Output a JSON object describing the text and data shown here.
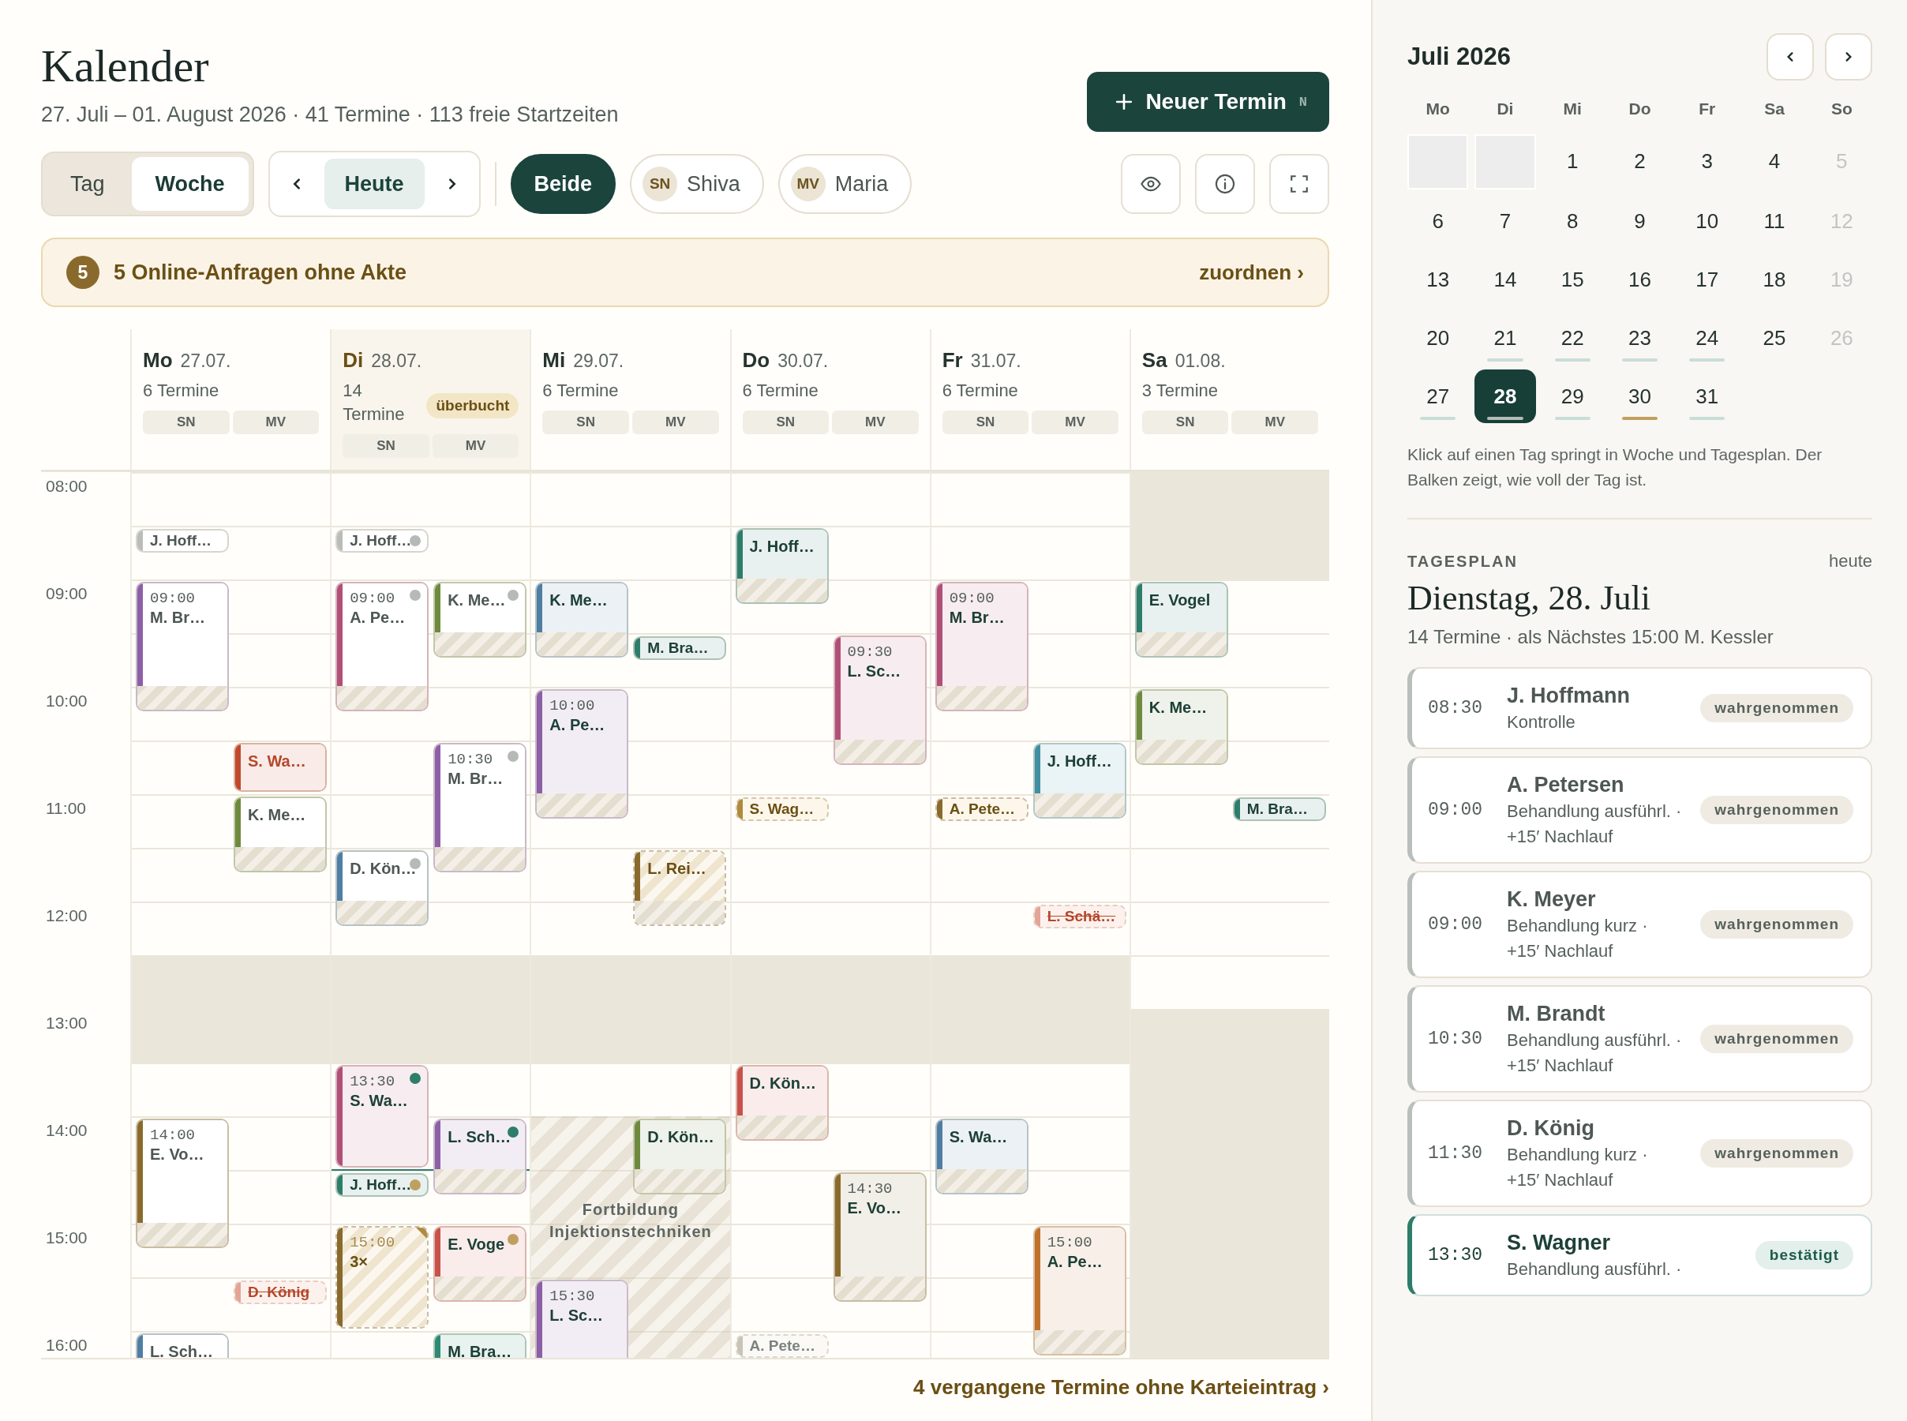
{
  "header": {
    "title": "Kalender",
    "subtitle": "27. Juli – 01. August 2026 · 41 Termine · 113 freie Startzeiten",
    "new_button": "Neuer Termin",
    "shortcut": "N"
  },
  "view_toggle": [
    {
      "label": "Tag",
      "selected": false
    },
    {
      "label": "Woche",
      "selected": true
    }
  ],
  "nav": {
    "today": "Heute"
  },
  "filters": [
    {
      "label": "Beide",
      "selected": true
    },
    {
      "initials": "SN",
      "label": "Shiva",
      "selected": false
    },
    {
      "initials": "MV",
      "label": "Maria",
      "selected": false
    }
  ],
  "banner": {
    "count": "5",
    "text": "5 Online-Anfragen ohne Akte",
    "action": "zuordnen ›"
  },
  "time_labels": [
    "08:00",
    "09:00",
    "10:00",
    "11:00",
    "12:00",
    "13:00",
    "14:00",
    "15:00",
    "16:00"
  ],
  "days": [
    {
      "name": "Mo",
      "date": "27.07.",
      "count": "6 Termine",
      "lanes": [
        "SN",
        "MV"
      ],
      "highlighted": false,
      "slots": [
        {
          "closed": false
        },
        {
          "closed": false,
          "sn": [
            {
              "kind": "pill-done",
              "label": "J. Hoff…",
              "color": "#b9bdb8"
            }
          ]
        },
        {
          "closed": false,
          "sn": [
            {
              "kind": "block-done",
              "long": true,
              "nachlauf": true,
              "time": "09:00",
              "label": "M. Br…",
              "color": "#8d5fa6"
            }
          ]
        },
        {
          "closed": false
        },
        {
          "closed": false
        },
        {
          "closed": false,
          "mv": [
            {
              "kind": "block-missed",
              "long": false,
              "nachlauf": false,
              "label": "S. Wa…",
              "color": "#c0482c"
            }
          ]
        },
        {
          "closed": false,
          "mv": [
            {
              "kind": "block-done",
              "long": false,
              "nachlauf": true,
              "label": "K. Me…",
              "color": "#6e8a3c"
            }
          ]
        },
        {
          "closed": false
        },
        {
          "closed": false
        },
        {
          "closed": true
        },
        {
          "closed": true
        },
        {
          "closed": false
        },
        {
          "closed": false,
          "sn": [
            {
              "kind": "block-done",
              "long": true,
              "nachlauf": true,
              "time": "14:00",
              "label": "E. Vo…",
              "color": "#8a6a2c"
            }
          ]
        },
        {
          "closed": false
        },
        {
          "closed": false
        },
        {
          "closed": false,
          "mv": [
            {
              "kind": "pill-cancelled",
              "label": "D. König",
              "color": "#e3a595"
            }
          ]
        },
        {
          "closed": false,
          "sn": [
            {
              "kind": "block-done",
              "long": false,
              "nachlauf": false,
              "label": "L. Sch…",
              "color": "#4f7ea3"
            }
          ]
        }
      ]
    },
    {
      "name": "Di",
      "date": "28.07.",
      "count": "14 Termine",
      "badge": "überbucht",
      "lanes": [
        "SN",
        "MV"
      ],
      "highlighted": true,
      "slots": [
        {
          "closed": false,
          "now": false
        },
        {
          "closed": false,
          "now": false,
          "sn": [
            {
              "kind": "pill-done",
              "label": "J. Hoff…",
              "color": "#b9bdb8",
              "dot": {
                "color": "#b5bab6"
              }
            }
          ]
        },
        {
          "closed": false,
          "now": false,
          "sn": [
            {
              "kind": "block-done",
              "long": true,
              "nachlauf": true,
              "time": "09:00",
              "label": "A. Pe…",
              "color": "#b24f78",
              "dot": {
                "color": "#b5bab6"
              }
            }
          ],
          "mv": [
            {
              "kind": "block-done",
              "long": false,
              "nachlauf": true,
              "label": "K. Me…",
              "color": "#6e8a3c",
              "dot": {
                "color": "#b5bab6"
              }
            }
          ]
        },
        {
          "closed": false,
          "now": false
        },
        {
          "closed": false,
          "now": false
        },
        {
          "closed": false,
          "now": false,
          "mv": [
            {
              "kind": "block-done",
              "long": true,
              "nachlauf": true,
              "time": "10:30",
              "label": "M. Br…",
              "color": "#8d5fa6",
              "dot": {
                "color": "#b5bab6"
              }
            }
          ]
        },
        {
          "closed": false,
          "now": false
        },
        {
          "closed": false,
          "now": false,
          "sn": [
            {
              "kind": "block-done",
              "long": false,
              "nachlauf": true,
              "label": "D. Kön…",
              "color": "#4f7ea3",
              "dot": {
                "color": "#b5bab6"
              }
            }
          ]
        },
        {
          "closed": false,
          "now": false
        },
        {
          "closed": true,
          "now": false
        },
        {
          "closed": true,
          "now": false
        },
        {
          "closed": false,
          "now": false,
          "sn": [
            {
              "kind": "block-confirmed",
              "long": true,
              "nachlauf": false,
              "time": "13:30",
              "label": "S. Wa…",
              "color": "#b24f78",
              "dot": {
                "color": "#2e7d6b"
              }
            }
          ]
        },
        {
          "closed": false,
          "now": false,
          "mv": [
            {
              "kind": "block-confirmed",
              "long": false,
              "nachlauf": true,
              "label": "L. Sch…",
              "color": "#8d5fa6",
              "dot": {
                "color": "#2e7d6b"
              }
            }
          ]
        },
        {
          "closed": false,
          "now": true,
          "sn": [
            {
              "kind": "pill-confirmed",
              "label": "J. Hoff…",
              "color": "#2e7d6b",
              "dot": {
                "color": "#c0a060"
              }
            }
          ]
        },
        {
          "closed": false,
          "now": false,
          "sn": [
            {
              "kind": "group",
              "long": true,
              "nachlauf": false,
              "time": "15:00",
              "label": "3×",
              "color": "#8a6a2c"
            }
          ],
          "mv": [
            {
              "kind": "block-confirmed",
              "long": false,
              "nachlauf": true,
              "label": "E. Voge",
              "color": "#c8524a",
              "dot": {
                "color": "#c0a060"
              }
            }
          ]
        },
        {
          "closed": false,
          "now": false
        },
        {
          "closed": false,
          "now": false,
          "mv": [
            {
              "kind": "block-confirmed",
              "long": false,
              "nachlauf": false,
              "label": "M. Bra…",
              "color": "#2e8a72"
            }
          ]
        }
      ]
    },
    {
      "name": "Mi",
      "date": "29.07.",
      "count": "6 Termine",
      "lanes": [
        "SN",
        "MV"
      ],
      "highlighted": false,
      "slots": [
        {
          "closed": false
        },
        {
          "closed": false
        },
        {
          "closed": false,
          "sn": [
            {
              "kind": "block-confirmed",
              "long": false,
              "nachlauf": true,
              "label": "K. Me…",
              "color": "#4f7ea3"
            }
          ]
        },
        {
          "closed": false,
          "mv": [
            {
              "kind": "pill-confirmed",
              "label": "M. Bra…",
              "color": "#2e7d6b"
            }
          ]
        },
        {
          "closed": false,
          "sn": [
            {
              "kind": "block-confirmed",
              "long": true,
              "nachlauf": true,
              "time": "10:00",
              "label": "A. Pe…",
              "color": "#8d5fa6"
            }
          ]
        },
        {
          "closed": false
        },
        {
          "closed": false
        },
        {
          "closed": false,
          "mv": [
            {
              "kind": "block-request",
              "long": false,
              "nachlauf": true,
              "label": "L. Rei…",
              "color": "#8a6a2c"
            }
          ]
        },
        {
          "closed": false
        },
        {
          "closed": true
        },
        {
          "closed": true
        },
        {
          "closed": false
        },
        {
          "closed": false,
          "mv": [
            {
              "kind": "block-confirmed",
              "long": false,
              "nachlauf": true,
              "label": "D. Kön…",
              "color": "#6e8a3c"
            }
          ],
          "training": {
            "label": "Fortbildung Injektionstechniken"
          }
        },
        {
          "closed": false
        },
        {
          "closed": false
        },
        {
          "closed": false,
          "sn": [
            {
              "kind": "block-confirmed",
              "long": true,
              "nachlauf": false,
              "time": "15:30",
              "label": "L. Sc…",
              "color": "#8d5fa6"
            }
          ]
        },
        {
          "closed": false
        }
      ]
    },
    {
      "name": "Do",
      "date": "30.07.",
      "count": "6 Termine",
      "lanes": [
        "SN",
        "MV"
      ],
      "highlighted": false,
      "slots": [
        {
          "closed": false
        },
        {
          "closed": false,
          "sn": [
            {
              "kind": "block-confirmed",
              "long": false,
              "nachlauf": true,
              "label": "J. Hoff…",
              "color": "#2e7d6b"
            }
          ]
        },
        {
          "closed": false
        },
        {
          "closed": false,
          "mv": [
            {
              "kind": "block-confirmed",
              "long": true,
              "nachlauf": true,
              "time": "09:30",
              "label": "L. Sc…",
              "color": "#b24f78"
            }
          ]
        },
        {
          "closed": false
        },
        {
          "closed": false
        },
        {
          "closed": false,
          "sn": [
            {
              "kind": "pill-request",
              "label": "S. Wag…",
              "color": "#b08a3e"
            }
          ]
        },
        {
          "closed": false
        },
        {
          "closed": false
        },
        {
          "closed": true
        },
        {
          "closed": true
        },
        {
          "closed": false,
          "sn": [
            {
              "kind": "block-confirmed",
              "long": false,
              "nachlauf": true,
              "label": "D. Kön…",
              "color": "#c8524a"
            }
          ]
        },
        {
          "closed": false
        },
        {
          "closed": false,
          "mv": [
            {
              "kind": "block-confirmed",
              "long": true,
              "nachlauf": true,
              "time": "14:30",
              "label": "E. Vo…",
              "color": "#8a6a2c"
            }
          ]
        },
        {
          "closed": false
        },
        {
          "closed": false
        },
        {
          "closed": false,
          "sn": [
            {
              "kind": "pill-lapsed",
              "label": "A. Pete…",
              "color": "#c9c4b8"
            }
          ]
        }
      ]
    },
    {
      "name": "Fr",
      "date": "31.07.",
      "count": "6 Termine",
      "lanes": [
        "SN",
        "MV"
      ],
      "highlighted": false,
      "slots": [
        {
          "closed": false
        },
        {
          "closed": false
        },
        {
          "closed": false,
          "sn": [
            {
              "kind": "block-confirmed",
              "long": true,
              "nachlauf": true,
              "time": "09:00",
              "label": "M. Br…",
              "color": "#b24f78"
            }
          ]
        },
        {
          "closed": false
        },
        {
          "closed": false
        },
        {
          "closed": false,
          "mv": [
            {
              "kind": "block-confirmed",
              "long": false,
              "nachlauf": true,
              "label": "J. Hoff…",
              "color": "#3f8fa0"
            }
          ]
        },
        {
          "closed": false,
          "sn": [
            {
              "kind": "pill-request",
              "label": "A. Pete…",
              "color": "#8a6a2c"
            }
          ]
        },
        {
          "closed": false
        },
        {
          "closed": false,
          "mv": [
            {
              "kind": "pill-cancelled",
              "label": "L. Schä…",
              "color": "#e3a595"
            }
          ]
        },
        {
          "closed": true
        },
        {
          "closed": true
        },
        {
          "closed": false
        },
        {
          "closed": false,
          "sn": [
            {
              "kind": "block-confirmed",
              "long": false,
              "nachlauf": true,
              "label": "S. Wa…",
              "color": "#4f7ea3"
            }
          ]
        },
        {
          "closed": false
        },
        {
          "closed": false,
          "mv": [
            {
              "kind": "block-confirmed",
              "long": true,
              "nachlauf": true,
              "time": "15:00",
              "label": "A. Pe…",
              "color": "#c0722d"
            }
          ]
        },
        {
          "closed": false
        },
        {
          "closed": false
        }
      ]
    },
    {
      "name": "Sa",
      "date": "01.08.",
      "count": "3 Termine",
      "lanes": [
        "SN",
        "MV"
      ],
      "highlighted": false,
      "slots": [
        {
          "closed": true
        },
        {
          "closed": true
        },
        {
          "closed": false,
          "sn": [
            {
              "kind": "block-confirmed",
              "long": false,
              "nachlauf": true,
              "label": "E. Vogel",
              "color": "#2e7d6b"
            }
          ]
        },
        {
          "closed": false
        },
        {
          "closed": false,
          "sn": [
            {
              "kind": "block-confirmed",
              "long": false,
              "nachlauf": true,
              "label": "K. Me…",
              "color": "#6e8a3c"
            }
          ]
        },
        {
          "closed": false
        },
        {
          "closed": false,
          "mv": [
            {
              "kind": "pill-confirmed",
              "label": "M. Bra…",
              "color": "#2e7d6b"
            }
          ]
        },
        {
          "closed": false
        },
        {
          "closed": false
        },
        {
          "closed": false
        },
        {
          "closed": true
        },
        {
          "closed": true
        },
        {
          "closed": true
        },
        {
          "closed": true
        },
        {
          "closed": true
        },
        {
          "closed": true
        },
        {
          "closed": true
        }
      ]
    }
  ],
  "footer_link": "4 vergangene Termine ohne Karteieintrag ›",
  "mini_calendar": {
    "title": "Juli 2026",
    "weekdays": [
      "Mo",
      "Di",
      "Mi",
      "Do",
      "Fr",
      "Sa",
      "So"
    ],
    "weeks": [
      [
        {
          "kind": "blank"
        },
        {
          "kind": "blank"
        },
        {
          "kind": "day",
          "label": "1",
          "muted": false,
          "selected": false
        },
        {
          "kind": "day",
          "label": "2",
          "muted": false,
          "selected": false
        },
        {
          "kind": "day",
          "label": "3",
          "muted": false,
          "selected": false
        },
        {
          "kind": "day",
          "label": "4",
          "muted": false,
          "selected": false
        },
        {
          "kind": "day",
          "label": "5",
          "muted": true,
          "selected": false
        }
      ],
      [
        {
          "kind": "day",
          "label": "6",
          "muted": false,
          "selected": false
        },
        {
          "kind": "day",
          "label": "7",
          "muted": false,
          "selected": false
        },
        {
          "kind": "day",
          "label": "8",
          "muted": false,
          "selected": false
        },
        {
          "kind": "day",
          "label": "9",
          "muted": false,
          "selected": false
        },
        {
          "kind": "day",
          "label": "10",
          "muted": false,
          "selected": false
        },
        {
          "kind": "day",
          "label": "11",
          "muted": false,
          "selected": false
        },
        {
          "kind": "day",
          "label": "12",
          "muted": true,
          "selected": false
        }
      ],
      [
        {
          "kind": "day",
          "label": "13",
          "muted": false,
          "selected": false
        },
        {
          "kind": "day",
          "label": "14",
          "muted": false,
          "selected": false
        },
        {
          "kind": "day",
          "label": "15",
          "muted": false,
          "selected": false
        },
        {
          "kind": "day",
          "label": "16",
          "muted": false,
          "selected": false
        },
        {
          "kind": "day",
          "label": "17",
          "muted": false,
          "selected": false
        },
        {
          "kind": "day",
          "label": "18",
          "muted": false,
          "selected": false
        },
        {
          "kind": "day",
          "label": "19",
          "muted": true,
          "selected": false
        }
      ],
      [
        {
          "kind": "day",
          "label": "20",
          "muted": false,
          "selected": false
        },
        {
          "kind": "day",
          "label": "21",
          "muted": false,
          "selected": false,
          "bar": {
            "color": "#c9ddd7"
          }
        },
        {
          "kind": "day",
          "label": "22",
          "muted": false,
          "selected": false,
          "bar": {
            "color": "#c9ddd7"
          }
        },
        {
          "kind": "day",
          "label": "23",
          "muted": false,
          "selected": false,
          "bar": {
            "color": "#c9ddd7"
          }
        },
        {
          "kind": "day",
          "label": "24",
          "muted": false,
          "selected": false,
          "bar": {
            "color": "#c9ddd7"
          }
        },
        {
          "kind": "day",
          "label": "25",
          "muted": false,
          "selected": false
        },
        {
          "kind": "day",
          "label": "26",
          "muted": true,
          "selected": false
        }
      ],
      [
        {
          "kind": "day",
          "label": "27",
          "muted": false,
          "selected": false,
          "bar": {
            "color": "#c9ddd7"
          }
        },
        {
          "kind": "day",
          "label": "28",
          "muted": false,
          "selected": true,
          "bar": {
            "color": "#b3bcb7"
          }
        },
        {
          "kind": "day",
          "label": "29",
          "muted": false,
          "selected": false,
          "bar": {
            "color": "#c9ddd7"
          }
        },
        {
          "kind": "day",
          "label": "30",
          "muted": false,
          "selected": false,
          "bar": {
            "color": "#c0a060"
          }
        },
        {
          "kind": "day",
          "label": "31",
          "muted": false,
          "selected": false,
          "bar": {
            "color": "#c9ddd7"
          }
        }
      ]
    ],
    "note": "Klick auf einen Tag springt in Woche und Tagesplan. Der Balken zeigt, wie voll der Tag ist."
  },
  "day_plan": {
    "label": "TAGESPLAN",
    "link": "heute",
    "title": "Dienstag, 28. Juli",
    "subtitle": "14 Termine · als Nächstes 15:00 M. Kessler",
    "items": [
      {
        "time": "08:30",
        "name": "J. Hoffmann",
        "detail": "Kontrolle",
        "status": "wahrgenommen",
        "kind": "done"
      },
      {
        "time": "09:00",
        "name": "A. Petersen",
        "detail": "Behandlung ausführl. · +15′ Nachlauf",
        "status": "wahrgenommen",
        "kind": "done"
      },
      {
        "time": "09:00",
        "name": "K. Meyer",
        "detail": "Behandlung kurz · +15′ Nachlauf",
        "status": "wahrgenommen",
        "kind": "done"
      },
      {
        "time": "10:30",
        "name": "M. Brandt",
        "detail": "Behandlung ausführl. · +15′ Nachlauf",
        "status": "wahrgenommen",
        "kind": "done"
      },
      {
        "time": "11:30",
        "name": "D. König",
        "detail": "Behandlung kurz · +15′ Nachlauf",
        "status": "wahrgenommen",
        "kind": "done"
      },
      {
        "time": "13:30",
        "name": "S. Wagner",
        "detail": "Behandlung ausführl. ·",
        "status": "bestätigt",
        "kind": "confirmed"
      }
    ]
  }
}
